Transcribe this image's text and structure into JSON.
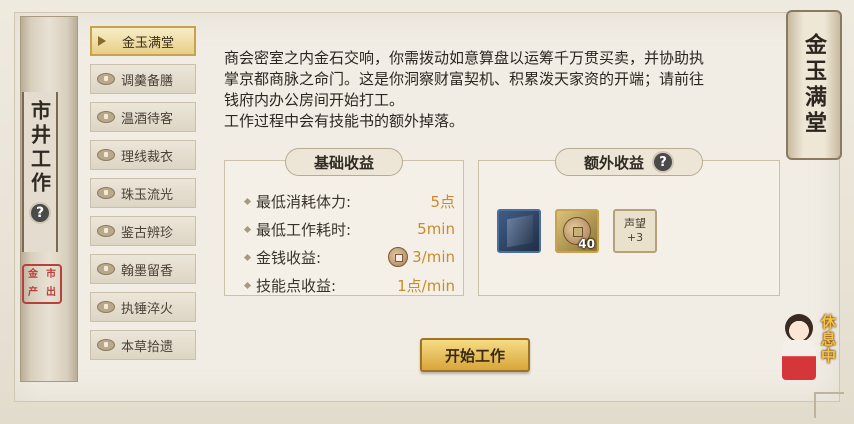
{
  "left_scroll": {
    "title": "市井工作",
    "seal_text": [
      "金",
      "市",
      "产",
      "出"
    ]
  },
  "menu": {
    "items": [
      {
        "label": "金玉满堂",
        "active": true
      },
      {
        "label": "调羹备膳",
        "active": false
      },
      {
        "label": "温酒待客",
        "active": false
      },
      {
        "label": "理线裁衣",
        "active": false
      },
      {
        "label": "珠玉流光",
        "active": false
      },
      {
        "label": "鉴古辨珍",
        "active": false
      },
      {
        "label": "翰墨留香",
        "active": false
      },
      {
        "label": "执锤淬火",
        "active": false
      },
      {
        "label": "本草拾遗",
        "active": false
      }
    ]
  },
  "description": {
    "line1": "商会密室之内金石交响，你需拨动如意算盘以运筹千万贯买卖，并协助执",
    "line2": "掌京都商脉之命门。这是你洞察财富契机、积累泼天家资的开端；请前往",
    "line3": "钱府内办公房间开始打工。",
    "line4": "工作过程中会有技能书的额外掉落。"
  },
  "basic_panel": {
    "title": "基础收益",
    "rows": [
      {
        "label": "最低消耗体力:",
        "value": "5点",
        "icon": ""
      },
      {
        "label": "最低工作耗时:",
        "value": "5min",
        "icon": ""
      },
      {
        "label": "金钱收益:",
        "value": "3/min",
        "icon": "coin-icon"
      },
      {
        "label": "技能点收益:",
        "value": "1点/min",
        "icon": ""
      }
    ]
  },
  "extra_panel": {
    "title": "额外收益",
    "items": [
      {
        "name": "skill-book",
        "icon": "book-icon"
      },
      {
        "name": "copper-coin",
        "icon": "coin-icon",
        "quantity": "40"
      },
      {
        "name": "reputation",
        "label": "声望",
        "quantity": "+3"
      }
    ]
  },
  "start_button": {
    "label": "开始工作"
  },
  "right_tag": {
    "title": "金玉满堂"
  },
  "character": {
    "status": "休息中"
  },
  "help_icon_text": "?",
  "colors": {
    "accent_gold": "#d9a53a",
    "value_orange": "#c98b2c",
    "seal_red": "#b8403a"
  }
}
